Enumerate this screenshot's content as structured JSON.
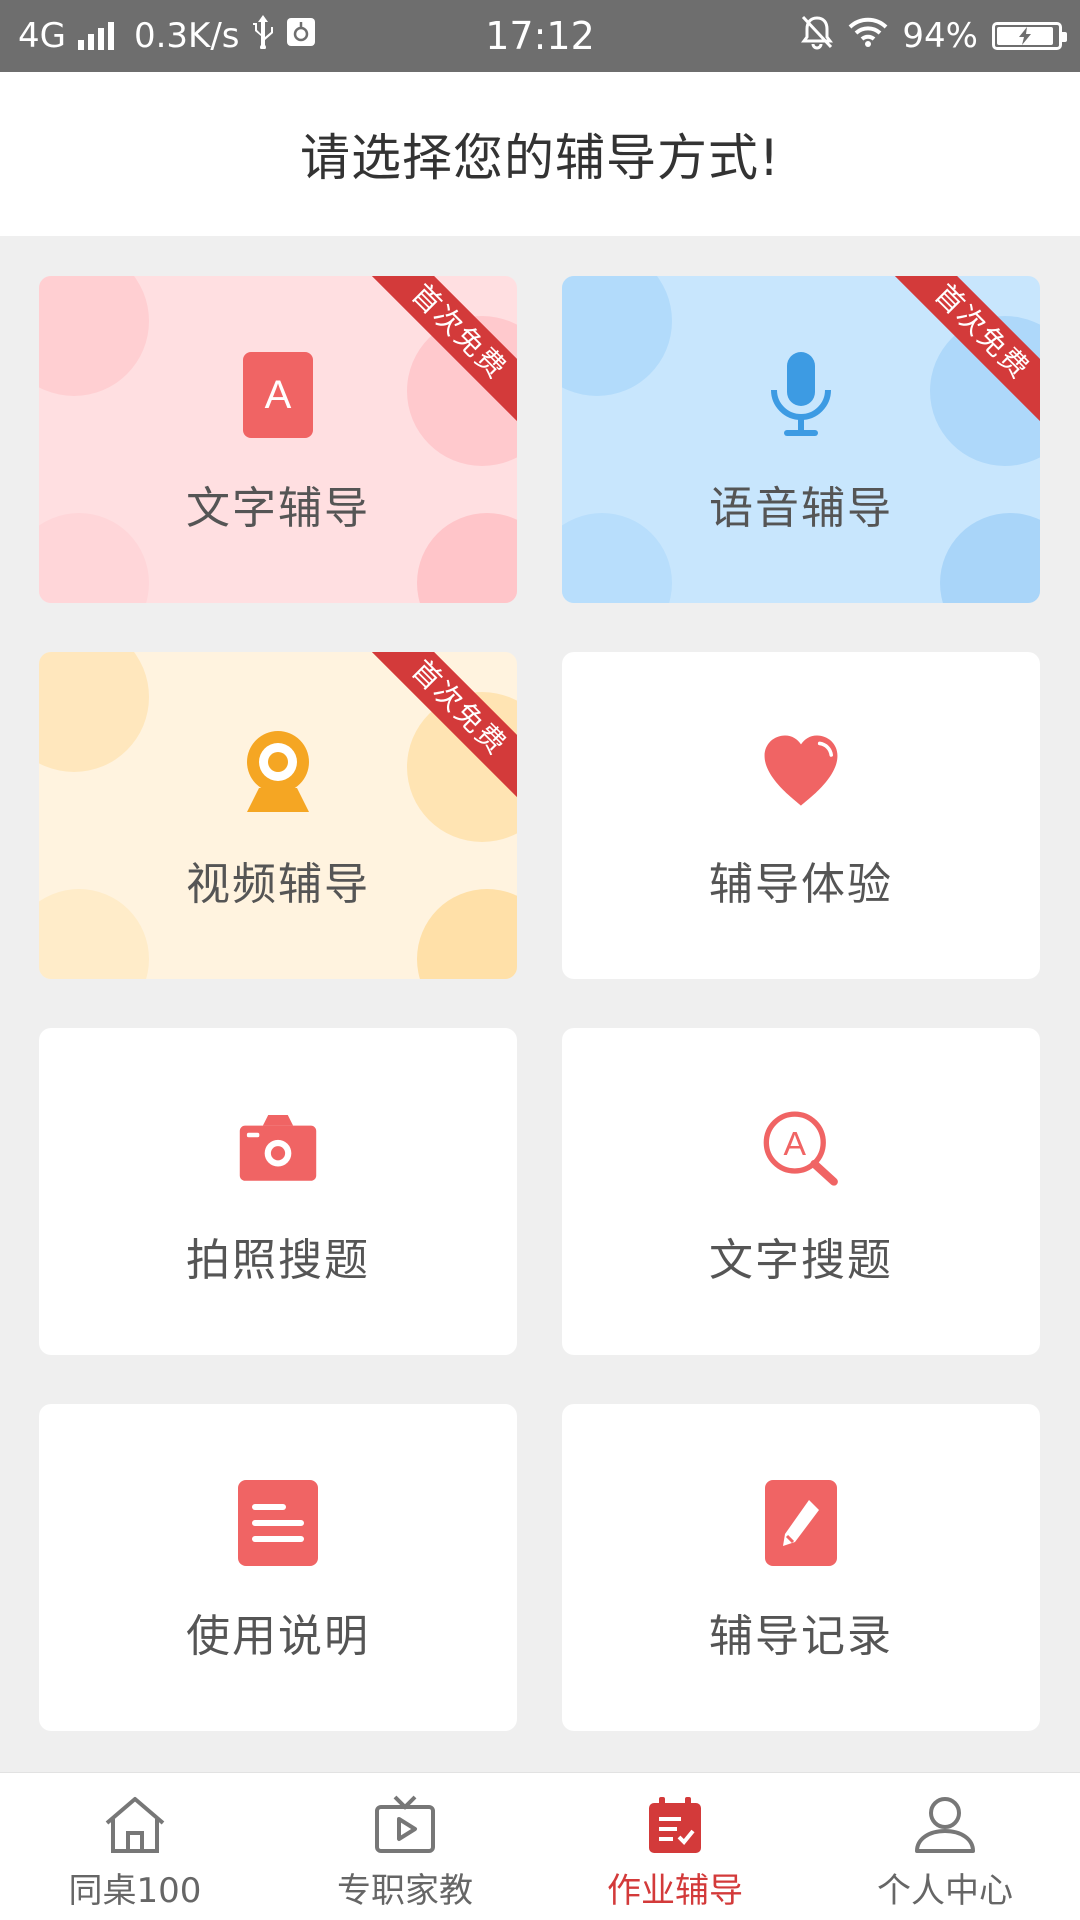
{
  "status_bar": {
    "network": "4G",
    "speed": "0.3K/s",
    "time": "17:12",
    "battery": "94%",
    "battery_level": 0.94
  },
  "header": {
    "title": "请选择您的辅导方式!"
  },
  "cards": [
    {
      "label": "文字辅导",
      "badge": "首次免费",
      "icon": "letter-a-icon",
      "theme": "pink"
    },
    {
      "label": "语音辅导",
      "badge": "首次免费",
      "icon": "microphone-icon",
      "theme": "blue"
    },
    {
      "label": "视频辅导",
      "badge": "首次免费",
      "icon": "webcam-icon",
      "theme": "yellow"
    },
    {
      "label": "辅导体验",
      "icon": "heart-icon",
      "theme": "white"
    },
    {
      "label": "拍照搜题",
      "icon": "camera-icon",
      "theme": "white"
    },
    {
      "label": "文字搜题",
      "icon": "search-letter-icon",
      "theme": "white"
    },
    {
      "label": "使用说明",
      "icon": "document-icon",
      "theme": "white"
    },
    {
      "label": "辅导记录",
      "icon": "edit-icon",
      "theme": "white"
    }
  ],
  "bottom_nav": {
    "items": [
      {
        "label": "同桌100",
        "icon": "home-icon",
        "active": false
      },
      {
        "label": "专职家教",
        "icon": "tv-play-icon",
        "active": false
      },
      {
        "label": "作业辅导",
        "icon": "homework-calendar-icon",
        "active": true
      },
      {
        "label": "个人中心",
        "icon": "person-icon",
        "active": false
      }
    ]
  },
  "colors": {
    "accent": "#d33a3a",
    "icon_red": "#f06464",
    "mic_blue": "#3d9be3",
    "webcam_orange": "#f5a623",
    "background": "#efefef"
  }
}
